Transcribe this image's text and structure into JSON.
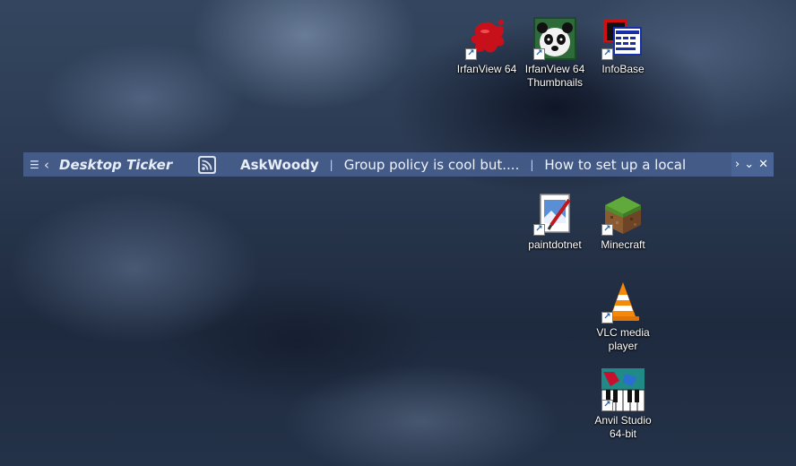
{
  "desktop": {
    "icons": [
      {
        "id": "irfanview64",
        "label": "IrfanView 64",
        "icon": "red-splat-icon"
      },
      {
        "id": "irfanview64-thumbs",
        "label": "IrfanView 64 Thumbnails",
        "icon": "panda-icon"
      },
      {
        "id": "infobase",
        "label": "InfoBase",
        "icon": "cards-icon"
      },
      {
        "id": "paintdotnet",
        "label": "paintdotnet",
        "icon": "paint-icon"
      },
      {
        "id": "minecraft",
        "label": "Minecraft",
        "icon": "grass-block-icon"
      },
      {
        "id": "vlc",
        "label": "VLC media player",
        "icon": "traffic-cone-icon"
      },
      {
        "id": "anvil",
        "label": "Anvil Studio 64-bit",
        "icon": "piano-keys-icon"
      }
    ],
    "shortcut_glyph": "↗"
  },
  "ticker": {
    "menu_glyph": "☰",
    "prev_glyph": "‹",
    "title": "Desktop Ticker",
    "feed_name": "AskWoody",
    "separator": "|",
    "items": [
      "Group policy is cool but....",
      "How to set up a local"
    ],
    "next_glyph": "›",
    "collapse_glyph": "⌄",
    "close_glyph": "✕"
  }
}
